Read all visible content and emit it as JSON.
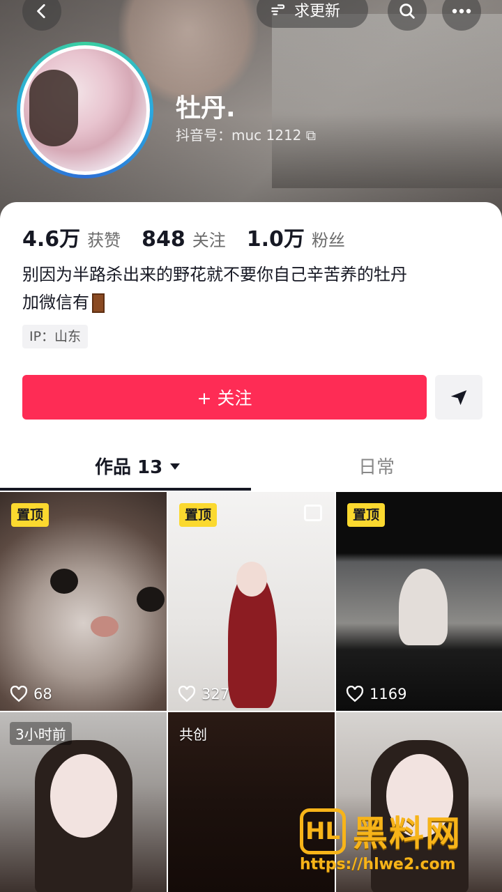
{
  "header": {
    "update_label": "求更新",
    "nickname": "牡丹.",
    "douyin_id": "抖音号：muc        1212 ⧉"
  },
  "stats": [
    {
      "value": "4.6万",
      "label": "获赞"
    },
    {
      "value": "848",
      "label": "关注"
    },
    {
      "value": "1.0万",
      "label": "粉丝"
    }
  ],
  "bio": {
    "line1": "别因为半路杀出来的野花就不要你自己辛苦养的牡丹",
    "line2": "加微信有"
  },
  "ip_tag": "IP：山东",
  "actions": {
    "follow_label": "+ 关注"
  },
  "tabs": {
    "works_label": "作品 13",
    "daily_label": "日常"
  },
  "grid": [
    {
      "tag": "置顶",
      "likes": "68"
    },
    {
      "tag": "置顶",
      "likes": "327"
    },
    {
      "tag": "置顶",
      "likes": "1169"
    },
    {
      "tag": "3小时前"
    },
    {
      "tag": "共创"
    },
    {
      "tag": ""
    }
  ],
  "watermark": {
    "logo": "HL",
    "title": "黑料网",
    "url": "https://hlwe2.com"
  },
  "colors": {
    "accent": "#fe2c55",
    "pin": "#fbd92f",
    "watermark": "#f7b419"
  }
}
